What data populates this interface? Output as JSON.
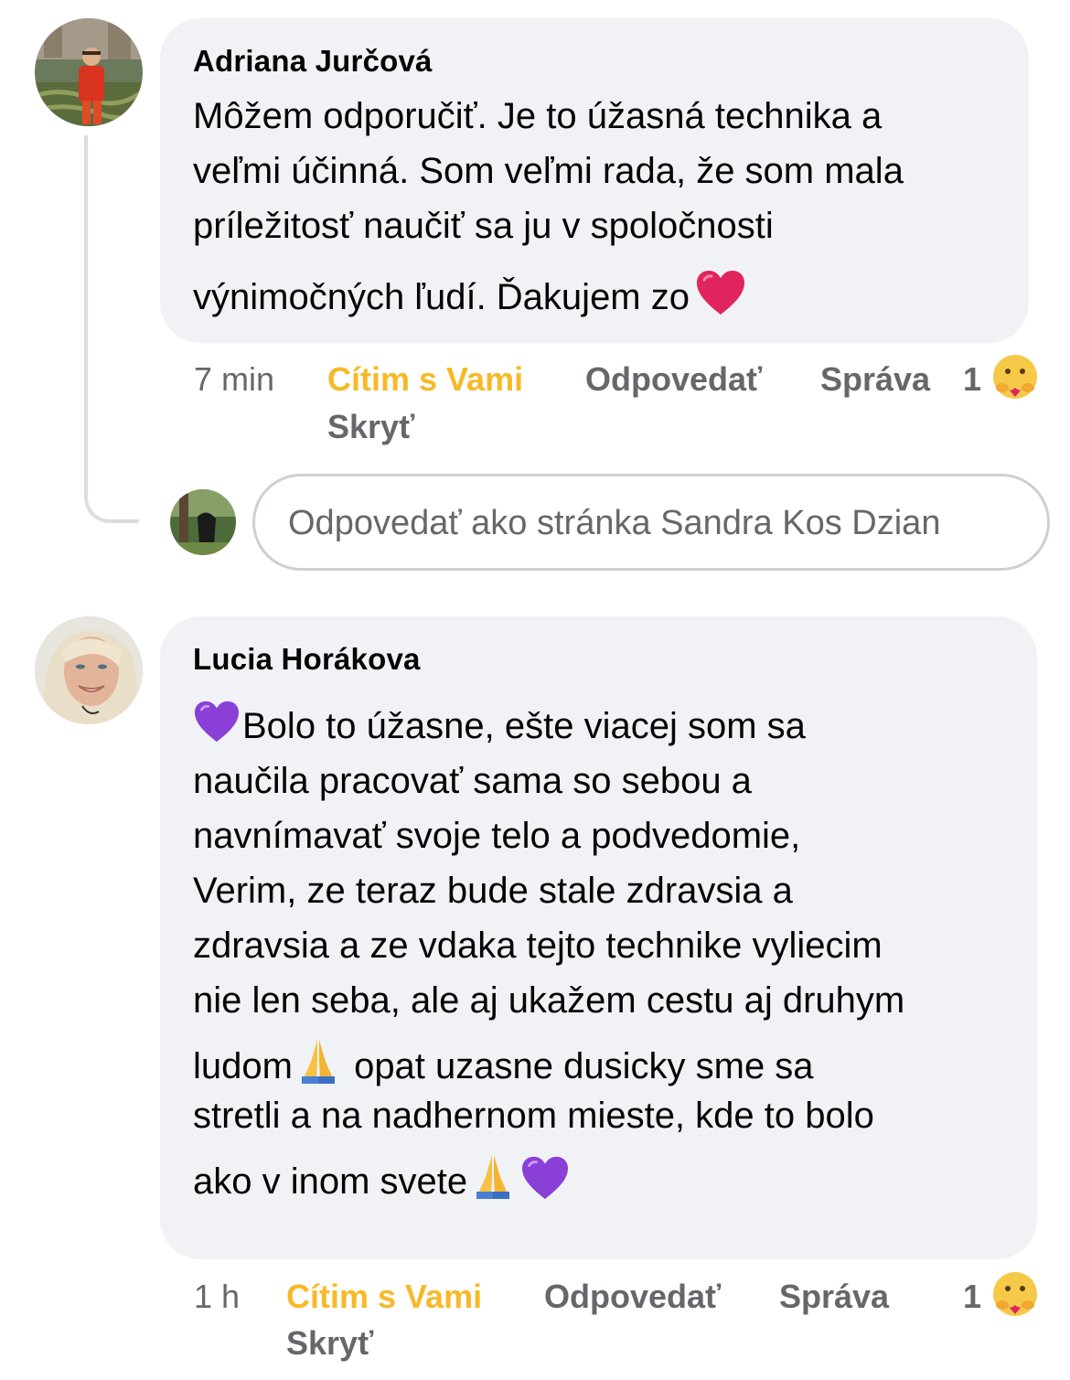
{
  "comments": [
    {
      "author": "Adriana Jurčová",
      "lines": [
        "Môžem odporučiť. Je to úžasná technika a",
        "veľmi účinná. Som veľmi rada, že som mala",
        "príležitosť naučiť sa ju v spoločnosti",
        "výnimočných ľudí. Ďakujem zo"
      ],
      "time": "7 min",
      "reaction_label": "Cítim s Vami",
      "reply_label": "Odpovedať",
      "message_label": "Správa",
      "hide_label": "Skryť",
      "reaction_count": "1"
    },
    {
      "author": "Lucia Horákova",
      "lines": [
        "Bolo to úžasne, ešte viacej som sa",
        "naučila pracovať sama so sebou a",
        "navnímavať svoje telo a podvedomie,",
        "Verim, ze teraz  bude stale zdravsia a",
        "zdravsia a ze vdaka tejto technike vyliecim",
        "nie len seba, ale aj ukažem cestu aj druhym",
        "ludom",
        "  opat uzasne dusicky sme sa",
        "stretli a na nadhernom mieste, kde to bolo",
        "ako v inom svete"
      ],
      "time": "1 h",
      "reaction_label": "Cítim s Vami",
      "reply_label": "Odpovedať",
      "message_label": "Správa",
      "hide_label": "Skryť",
      "reaction_count": "1"
    }
  ],
  "reply_box": {
    "placeholder": "Odpovedať ako stránka Sandra Kos Dzian"
  },
  "colors": {
    "bubble": "#f0f2f5",
    "meta": "#65676b",
    "reaction_label": "#f7b928",
    "heart": "#e0245e",
    "purple_heart": "#8a3fd6"
  },
  "icons": {
    "heart": "red-heart-emoji",
    "purple_heart": "purple-heart-emoji",
    "pray": "folded-hands-emoji",
    "reaction": "care-reaction-icon"
  }
}
